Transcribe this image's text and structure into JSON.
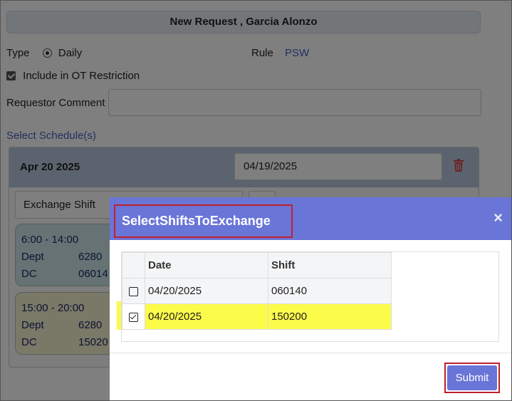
{
  "header": {
    "title": "New Request , Garcia Alonzo"
  },
  "form": {
    "type_label": "Type",
    "type_value": "Daily",
    "rule_label": "Rule",
    "rule_value": "PSW",
    "ot_label": "Include in OT Restriction",
    "ot_checked": true,
    "comment_label": "Requestor Comment",
    "comment_value": "",
    "select_schedule_label": "Select Schedule(s)"
  },
  "schedule": {
    "date_title": "Apr 20 2025",
    "date_input": "04/19/2025",
    "exchange_select": "Exchange Shift",
    "cards": [
      {
        "time": "6:00 - 14:00",
        "dept_label": "Dept",
        "dept": "6280",
        "dc_label": "DC",
        "dc": "06014"
      },
      {
        "time": "15:00 - 20:00",
        "dept_label": "Dept",
        "dept": "6280",
        "dc_label": "DC",
        "dc": "15020"
      }
    ]
  },
  "modal": {
    "title": "SelectShiftsToExchange",
    "close": "×",
    "columns": [
      "Date",
      "Shift"
    ],
    "rows": [
      {
        "date": "04/20/2025",
        "shift": "060140",
        "checked": false
      },
      {
        "date": "04/20/2025",
        "shift": "150200",
        "checked": true
      }
    ],
    "submit_label": "Submit"
  },
  "colors": {
    "accent": "#6a75d8",
    "highlight": "#fbfb4a",
    "annotation": "#c0202a"
  }
}
